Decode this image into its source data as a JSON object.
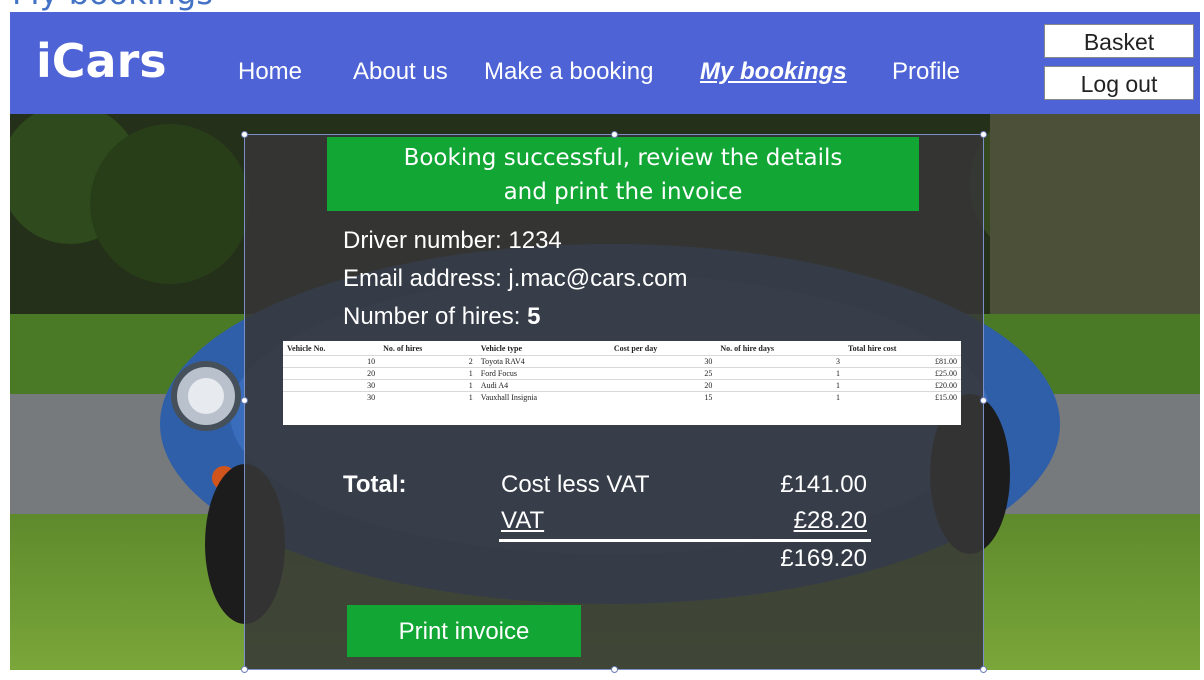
{
  "page": {
    "heading": "My bookings"
  },
  "nav": {
    "logo": "iCars",
    "links": [
      "Home",
      "About us",
      "Make a booking",
      "My bookings",
      "Profile"
    ],
    "active": "My bookings",
    "basket_label": "Basket",
    "logout_label": "Log out"
  },
  "colors": {
    "nav_bg": "#4d63d6",
    "accent_green": "#12a635"
  },
  "booking": {
    "banner_line1": "Booking successful, review the details",
    "banner_line2": "and print the invoice",
    "driver_label": "Driver number: ",
    "driver_number": "1234",
    "email_label": "Email address: ",
    "email": "j.mac@cars.com",
    "hires_label": "Number of hires: ",
    "hires_count": "5"
  },
  "table": {
    "headers": [
      "Vehicle No.",
      "No. of hires",
      "Vehicle type",
      "Cost per day",
      "No. of hire days",
      "Total hire cost"
    ],
    "rows": [
      [
        "10",
        "2",
        "Toyota RAV4",
        "30",
        "3",
        "£81.00"
      ],
      [
        "20",
        "1",
        "Ford Focus",
        "25",
        "1",
        "£25.00"
      ],
      [
        "30",
        "1",
        "Audi A4",
        "20",
        "1",
        "£20.00"
      ],
      [
        "30",
        "1",
        "Vauxhall Insignia",
        "15",
        "1",
        "£15.00"
      ]
    ]
  },
  "summary": {
    "total_label": "Total:",
    "cost_less_vat_label": "Cost less VAT",
    "cost_less_vat": "£141.00",
    "vat_label": "VAT",
    "vat": "£28.20",
    "grand_total": "£169.20"
  },
  "actions": {
    "print_label": "Print invoice"
  }
}
